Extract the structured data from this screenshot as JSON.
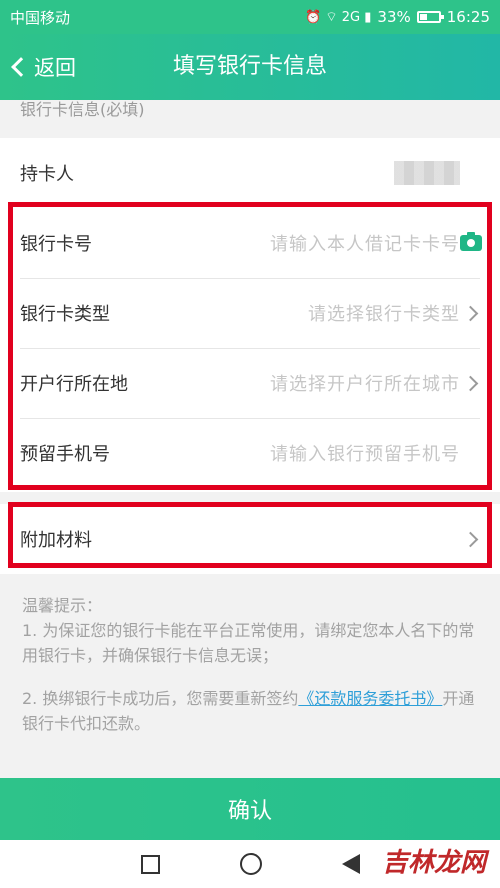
{
  "status_bar": {
    "carrier": "中国移动",
    "network_icons": "⏰ ⌔ 2G ▮",
    "battery": "33%",
    "time": "16:25"
  },
  "header": {
    "back_label": "返回",
    "title": "填写银行卡信息"
  },
  "section_label": "银行卡信息(必填)",
  "form": {
    "holder": {
      "label": "持卡人"
    },
    "card_number": {
      "label": "银行卡号",
      "placeholder": "请输入本人借记卡卡号",
      "icon": "camera-icon"
    },
    "card_type": {
      "label": "银行卡类型",
      "placeholder": "请选择银行卡类型"
    },
    "bank_city": {
      "label": "开户行所在地",
      "placeholder": "请选择开户行所在城市"
    },
    "phone": {
      "label": "预留手机号",
      "placeholder": "请输入银行预留手机号"
    },
    "attachments": {
      "label": "附加材料"
    }
  },
  "tips": {
    "title": "温馨提示：",
    "tip1": "1. 为保证您的银行卡能在平台正常使用，请绑定您本人名下的常用银行卡，并确保银行卡信息无误；",
    "tip2_prefix": "2. 换绑银行卡成功后，您需要重新签约",
    "tip2_link": "《还款服务委托书》",
    "tip2_suffix": "开通银行卡代扣还款。"
  },
  "confirm_label": "确认",
  "watermark": "吉林龙网",
  "colors": {
    "accent": "#2ec38a",
    "highlight": "#e1001e",
    "link": "#2e9fd8"
  }
}
